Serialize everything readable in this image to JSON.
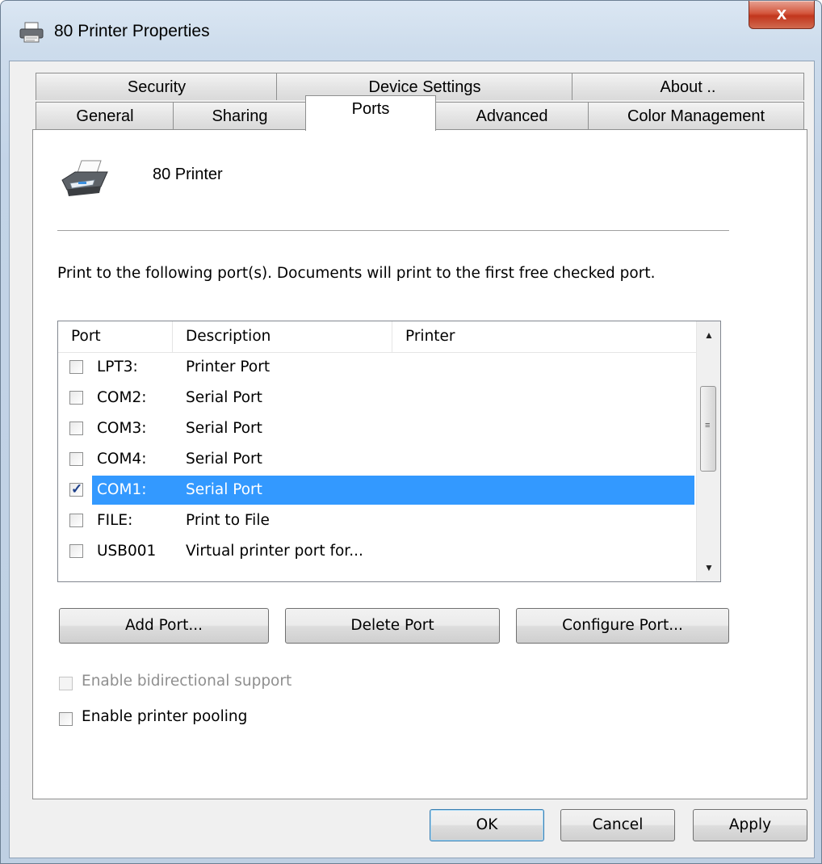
{
  "window": {
    "title": "80 Printer Properties",
    "close_label": "x"
  },
  "tabs": {
    "row_top": [
      {
        "label": "Security"
      },
      {
        "label": "Device Settings"
      },
      {
        "label": "About .."
      }
    ],
    "row_bottom": [
      {
        "label": "General"
      },
      {
        "label": "Sharing"
      },
      {
        "label": "Ports",
        "active": true
      },
      {
        "label": "Advanced"
      },
      {
        "label": "Color Management"
      }
    ]
  },
  "printer": {
    "name": "80 Printer",
    "icon": "printer-icon"
  },
  "instructions": "Print to the following port(s). Documents will print to the first free checked port.",
  "port_list": {
    "columns": [
      "Port",
      "Description",
      "Printer"
    ],
    "rows": [
      {
        "port": "LPT3:",
        "description": "Printer Port",
        "printer": "",
        "checked": false
      },
      {
        "port": "COM2:",
        "description": "Serial Port",
        "printer": "",
        "checked": false
      },
      {
        "port": "COM3:",
        "description": "Serial Port",
        "printer": "",
        "checked": false
      },
      {
        "port": "COM4:",
        "description": "Serial Port",
        "printer": "",
        "checked": false
      },
      {
        "port": "COM1:",
        "description": "Serial Port",
        "printer": "",
        "checked": true,
        "selected": true
      },
      {
        "port": "FILE:",
        "description": "Print to File",
        "printer": "",
        "checked": false
      },
      {
        "port": "USB001",
        "description": "Virtual printer port for...",
        "printer": "",
        "checked": false
      }
    ]
  },
  "port_buttons": {
    "add": "Add Port...",
    "delete": "Delete Port",
    "configure": "Configure Port..."
  },
  "options": {
    "bidirectional": {
      "label": "Enable bidirectional support",
      "checked": false,
      "enabled": false
    },
    "pooling": {
      "label": "Enable printer pooling",
      "checked": false,
      "enabled": true
    }
  },
  "dialog_buttons": {
    "ok": "OK",
    "cancel": "Cancel",
    "apply": "Apply"
  },
  "colors": {
    "selection": "#3399ff",
    "close_button": "#c2361d",
    "frame": "#c3d4e7"
  }
}
